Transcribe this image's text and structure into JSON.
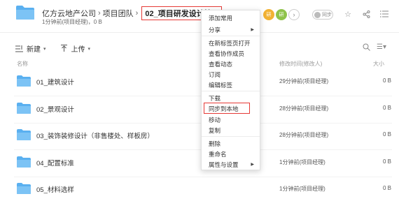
{
  "header": {
    "breadcrumb": [
      "亿方云地产公司",
      "项目团队"
    ],
    "current": "02_项目研发设计管...",
    "subinfo": "1分钟前(项目经理)，0 B",
    "avatars": [
      {
        "text": "研",
        "color": "#f2b233"
      },
      {
        "text": "研",
        "color": "#8fc34a"
      }
    ],
    "more_icon": "chevron-right-icon",
    "sync_label": "同步",
    "icons": [
      "star-icon",
      "share-icon",
      "list-menu-icon"
    ]
  },
  "toolbar": {
    "new_label": "新建",
    "upload_label": "上传"
  },
  "columns": {
    "name": "名称",
    "modified": "修改时间(修改人)",
    "size": "大小"
  },
  "rows": [
    {
      "name": "01_建筑设计",
      "time": "29分钟前(项目经理)",
      "size": "0 B"
    },
    {
      "name": "02_景观设计",
      "time": "28分钟前(项目经理)",
      "size": "0 B"
    },
    {
      "name": "03_装饰装修设计（非售楼处、样板房）",
      "time": "28分钟前(项目经理)",
      "size": "0 B"
    },
    {
      "name": "04_配置标准",
      "time": "1分钟前(项目经理)",
      "size": "0 B"
    },
    {
      "name": "05_材料选样",
      "time": "1分钟前(项目经理)",
      "size": "0 B"
    }
  ],
  "context_menu": {
    "items": [
      {
        "label": "添加常用",
        "submenu": false
      },
      {
        "label": "分享",
        "submenu": true
      },
      {
        "label": "在新标签页打开",
        "submenu": false
      },
      {
        "label": "查看协作成员",
        "submenu": false
      },
      {
        "label": "查看动态",
        "submenu": false
      },
      {
        "label": "订阅",
        "submenu": false
      },
      {
        "label": "编辑标签",
        "submenu": false
      },
      {
        "label": "下载",
        "submenu": false
      },
      {
        "label": "同步到本地",
        "submenu": false
      },
      {
        "label": "移动",
        "submenu": false
      },
      {
        "label": "复制",
        "submenu": false
      },
      {
        "label": "删除",
        "submenu": false
      },
      {
        "label": "重命名",
        "submenu": false
      },
      {
        "label": "属性与设置",
        "submenu": true
      }
    ],
    "highlighted": "同步到本地"
  },
  "colors": {
    "folder": "#5ab0f0",
    "highlight_border": "#e53935"
  }
}
